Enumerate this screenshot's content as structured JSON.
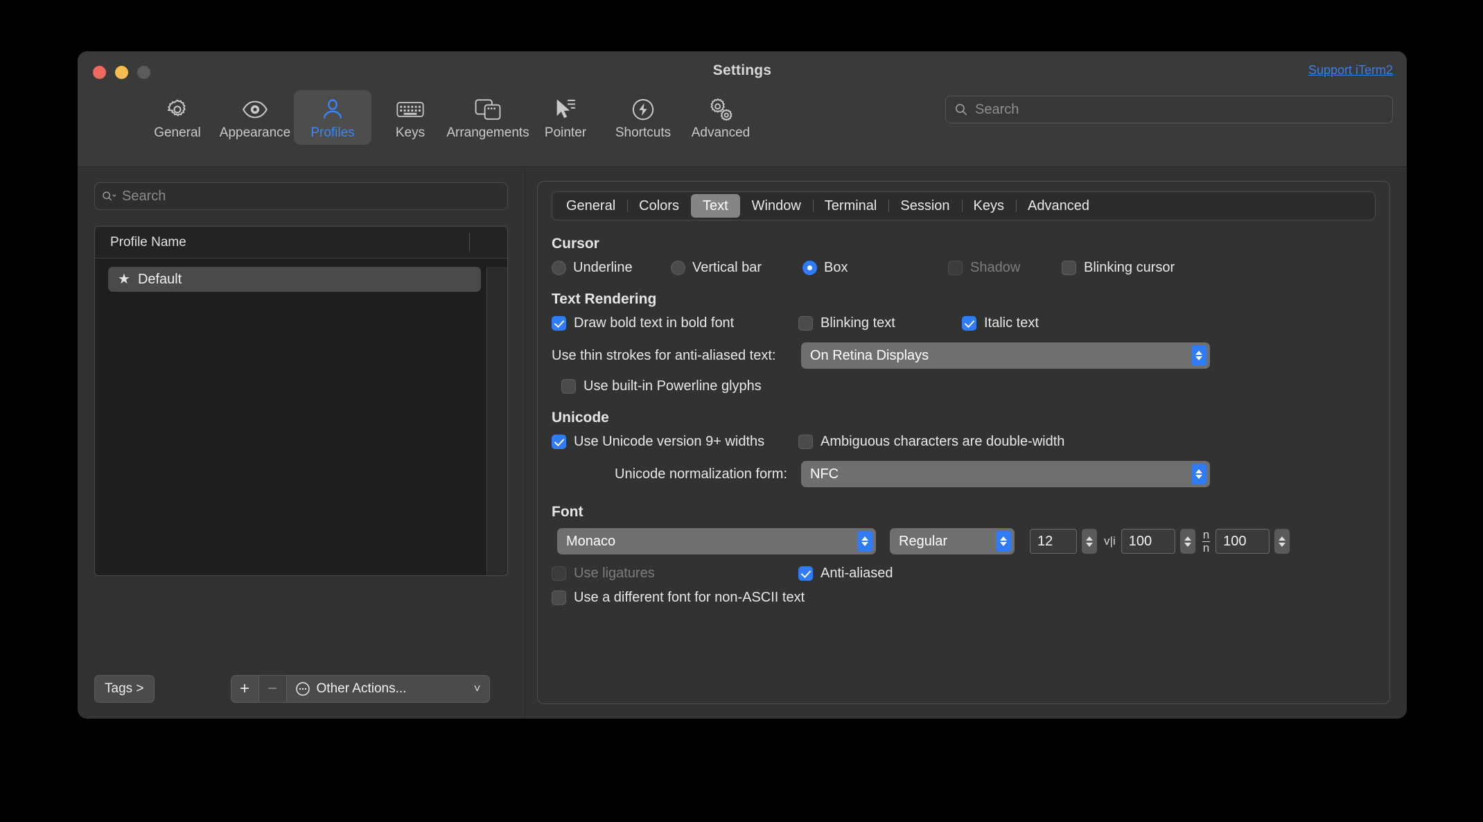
{
  "window": {
    "title": "Settings",
    "support_link": "Support iTerm2",
    "traffic_lights": [
      "close-button",
      "minimize-button",
      "zoom-button"
    ]
  },
  "toolbar": {
    "search_placeholder": "Search",
    "items": [
      {
        "label": "General",
        "icon": "gear-icon",
        "active": false
      },
      {
        "label": "Appearance",
        "icon": "eye-icon",
        "active": false
      },
      {
        "label": "Profiles",
        "icon": "person-icon",
        "active": true
      },
      {
        "label": "Keys",
        "icon": "keyboard-icon",
        "active": false
      },
      {
        "label": "Arrangements",
        "icon": "windows-icon",
        "active": false
      },
      {
        "label": "Pointer",
        "icon": "cursor-icon",
        "active": false
      },
      {
        "label": "Shortcuts",
        "icon": "bolt-icon",
        "active": false
      },
      {
        "label": "Advanced",
        "icon": "gears-icon",
        "active": false
      }
    ]
  },
  "sidebar": {
    "search_placeholder": "Search",
    "column_header": "Profile Name",
    "profiles": [
      {
        "name": "Default",
        "starred": true,
        "selected": true
      }
    ],
    "tags_button": "Tags >",
    "add_button": "+",
    "remove_button": "−",
    "other_actions": "Other Actions...",
    "other_actions_chevron": "˅"
  },
  "main": {
    "tabs": [
      {
        "label": "General",
        "active": false
      },
      {
        "label": "Colors",
        "active": false
      },
      {
        "label": "Text",
        "active": true
      },
      {
        "label": "Window",
        "active": false
      },
      {
        "label": "Terminal",
        "active": false
      },
      {
        "label": "Session",
        "active": false
      },
      {
        "label": "Keys",
        "active": false
      },
      {
        "label": "Advanced",
        "active": false
      }
    ],
    "cursor": {
      "heading": "Cursor",
      "options": [
        {
          "label": "Underline",
          "selected": false
        },
        {
          "label": "Vertical bar",
          "selected": false
        },
        {
          "label": "Box",
          "selected": true
        }
      ],
      "shadow": {
        "label": "Shadow",
        "checked": false,
        "disabled": true
      },
      "blinking_cursor": {
        "label": "Blinking cursor",
        "checked": false,
        "disabled": false
      }
    },
    "text_rendering": {
      "heading": "Text Rendering",
      "bold": {
        "label": "Draw bold text in bold font",
        "checked": true
      },
      "blinking": {
        "label": "Blinking text",
        "checked": false
      },
      "italic": {
        "label": "Italic text",
        "checked": true
      },
      "thin_strokes_label": "Use thin strokes for anti-aliased text:",
      "thin_strokes_value": "On Retina Displays",
      "powerline": {
        "label": "Use built-in Powerline glyphs",
        "checked": false
      }
    },
    "unicode": {
      "heading": "Unicode",
      "version9": {
        "label": "Use Unicode version 9+ widths",
        "checked": true
      },
      "ambiguous": {
        "label": "Ambiguous characters are double-width",
        "checked": false
      },
      "normalization_label": "Unicode normalization form:",
      "normalization_value": "NFC"
    },
    "font": {
      "heading": "Font",
      "family": "Monaco",
      "weight": "Regular",
      "size": "12",
      "horizontal_spacing": "100",
      "vertical_spacing": "100",
      "horizontal_icon": "v|i",
      "ligatures": {
        "label": "Use ligatures",
        "checked": false,
        "disabled": true
      },
      "antialiased": {
        "label": "Anti-aliased",
        "checked": true,
        "disabled": false
      },
      "non_ascii": {
        "label": "Use a different font for non-ASCII text",
        "checked": false,
        "disabled": false
      }
    }
  },
  "colors": {
    "accent": "#2f7cf6",
    "link": "#3b7fe8",
    "window_bg": "#323232",
    "titlebar_bg": "#3a3a3a",
    "list_bg": "#1e1e1e"
  }
}
